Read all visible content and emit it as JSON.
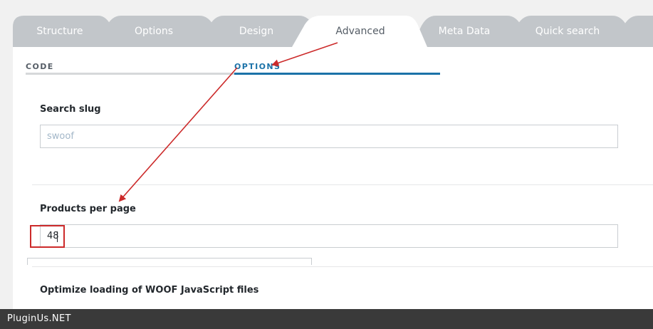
{
  "tabs": [
    {
      "label": "Structure",
      "active": false
    },
    {
      "label": "Options",
      "active": false
    },
    {
      "label": "Design",
      "active": false
    },
    {
      "label": "Advanced",
      "active": true
    },
    {
      "label": "Meta Data",
      "active": false
    },
    {
      "label": "Quick search",
      "active": false
    }
  ],
  "subtabs": {
    "code": "CODE",
    "options": "OPTIONS"
  },
  "fields": {
    "search_slug": {
      "label": "Search slug",
      "placeholder": "swoof",
      "value": ""
    },
    "products_per_page": {
      "label": "Products per page",
      "value": "48"
    },
    "optimize_loading": {
      "label": "Optimize loading of WOOF JavaScript files"
    }
  },
  "footer": {
    "brand": "PluginUs.NET"
  },
  "colors": {
    "tab_inactive": "#c2c6ca",
    "tab_active": "#ffffff",
    "accent_blue": "#1b72a8",
    "annotation_red": "#cc2a2a",
    "footer_bg": "#3a3a3a"
  }
}
